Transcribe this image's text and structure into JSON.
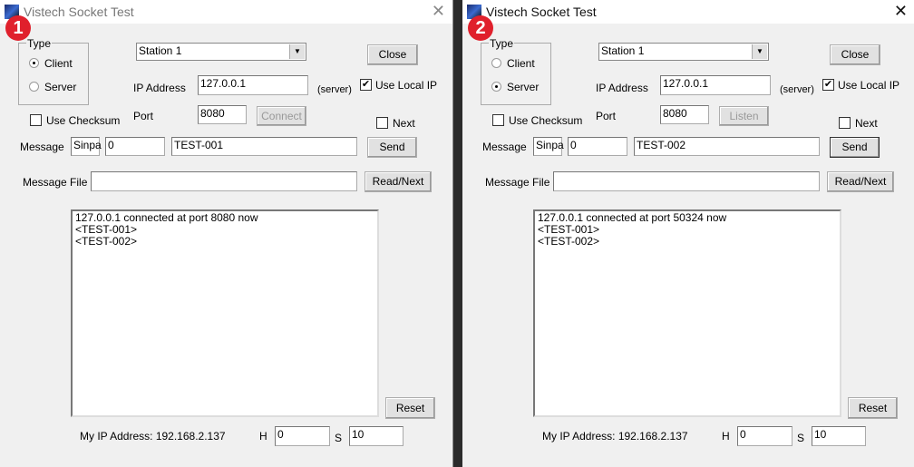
{
  "windows": [
    {
      "badge": "1",
      "title": "Vistech Socket Test",
      "type_label": "Type",
      "radio_client": "Client",
      "radio_server": "Server",
      "selected_type": "Client",
      "station": "Station 1",
      "close_label": "Close",
      "ip_label": "IP Address",
      "ip_value": "127.0.0.1",
      "server_note": "(server)",
      "use_local_ip_label": "Use Local IP",
      "use_local_ip_checked": true,
      "port_label": "Port",
      "port_value": "8080",
      "connect_label": "Connect",
      "use_checksum_label": "Use Checksum",
      "next_label": "Next",
      "message_label": "Message",
      "message_prefix": "Sinpa",
      "message_num": "0",
      "message_text": "TEST-001",
      "send_label": "Send",
      "message_file_label": "Message File",
      "message_file_value": "",
      "read_next_label": "Read/Next",
      "log": [
        "127.0.0.1 connected at port 8080 now",
        "<TEST-001>",
        "<TEST-002>"
      ],
      "reset_label": "Reset",
      "my_ip": "My IP Address: 192.168.2.137",
      "h_label": "H",
      "h_value": "0",
      "s_label": "S",
      "s_value": "10"
    },
    {
      "badge": "2",
      "title": "Vistech Socket Test",
      "type_label": "Type",
      "radio_client": "Client",
      "radio_server": "Server",
      "selected_type": "Server",
      "station": "Station 1",
      "close_label": "Close",
      "ip_label": "IP Address",
      "ip_value": "127.0.0.1",
      "server_note": "(server)",
      "use_local_ip_label": "Use Local IP",
      "use_local_ip_checked": true,
      "port_label": "Port",
      "port_value": "8080",
      "connect_label": "Listen",
      "use_checksum_label": "Use Checksum",
      "next_label": "Next",
      "message_label": "Message",
      "message_prefix": "Sinpa",
      "message_num": "0",
      "message_text": "TEST-002",
      "send_label": "Send",
      "message_file_label": "Message File",
      "message_file_value": "",
      "read_next_label": "Read/Next",
      "log": [
        "127.0.0.1 connected at port 50324 now",
        "<TEST-001>",
        "<TEST-002>"
      ],
      "reset_label": "Reset",
      "my_ip": "My IP Address: 192.168.2.137",
      "h_label": "H",
      "h_value": "0",
      "s_label": "S",
      "s_value": "10"
    }
  ]
}
